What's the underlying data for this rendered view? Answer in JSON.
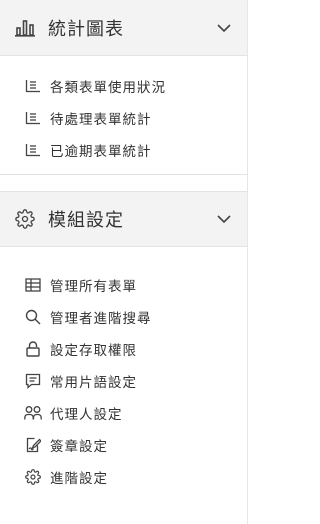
{
  "sections": [
    {
      "title": "統計圖表",
      "icon": "bar-chart-icon",
      "chevron_icon": "chevron-down-icon",
      "items": [
        {
          "label": "各類表單使用狀況",
          "icon": "list-icon"
        },
        {
          "label": "待處理表單統計",
          "icon": "list-icon"
        },
        {
          "label": "已逾期表單統計",
          "icon": "list-icon"
        }
      ]
    },
    {
      "title": "模組設定",
      "icon": "gear-icon",
      "chevron_icon": "chevron-down-icon",
      "items": [
        {
          "label": "管理所有表單",
          "icon": "table-icon"
        },
        {
          "label": "管理者進階搜尋",
          "icon": "search-icon"
        },
        {
          "label": "設定存取權限",
          "icon": "lock-icon"
        },
        {
          "label": "常用片語設定",
          "icon": "chat-icon"
        },
        {
          "label": "代理人設定",
          "icon": "users-icon"
        },
        {
          "label": "簽章設定",
          "icon": "signature-icon"
        },
        {
          "label": "進階設定",
          "icon": "gear-icon"
        }
      ]
    }
  ]
}
